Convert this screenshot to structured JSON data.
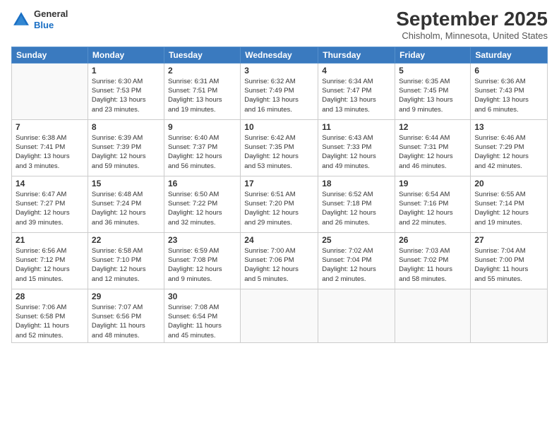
{
  "header": {
    "logo_line1": "General",
    "logo_line2": "Blue",
    "month": "September 2025",
    "location": "Chisholm, Minnesota, United States"
  },
  "weekdays": [
    "Sunday",
    "Monday",
    "Tuesday",
    "Wednesday",
    "Thursday",
    "Friday",
    "Saturday"
  ],
  "weeks": [
    [
      {
        "day": "",
        "info": ""
      },
      {
        "day": "1",
        "info": "Sunrise: 6:30 AM\nSunset: 7:53 PM\nDaylight: 13 hours\nand 23 minutes."
      },
      {
        "day": "2",
        "info": "Sunrise: 6:31 AM\nSunset: 7:51 PM\nDaylight: 13 hours\nand 19 minutes."
      },
      {
        "day": "3",
        "info": "Sunrise: 6:32 AM\nSunset: 7:49 PM\nDaylight: 13 hours\nand 16 minutes."
      },
      {
        "day": "4",
        "info": "Sunrise: 6:34 AM\nSunset: 7:47 PM\nDaylight: 13 hours\nand 13 minutes."
      },
      {
        "day": "5",
        "info": "Sunrise: 6:35 AM\nSunset: 7:45 PM\nDaylight: 13 hours\nand 9 minutes."
      },
      {
        "day": "6",
        "info": "Sunrise: 6:36 AM\nSunset: 7:43 PM\nDaylight: 13 hours\nand 6 minutes."
      }
    ],
    [
      {
        "day": "7",
        "info": "Sunrise: 6:38 AM\nSunset: 7:41 PM\nDaylight: 13 hours\nand 3 minutes."
      },
      {
        "day": "8",
        "info": "Sunrise: 6:39 AM\nSunset: 7:39 PM\nDaylight: 12 hours\nand 59 minutes."
      },
      {
        "day": "9",
        "info": "Sunrise: 6:40 AM\nSunset: 7:37 PM\nDaylight: 12 hours\nand 56 minutes."
      },
      {
        "day": "10",
        "info": "Sunrise: 6:42 AM\nSunset: 7:35 PM\nDaylight: 12 hours\nand 53 minutes."
      },
      {
        "day": "11",
        "info": "Sunrise: 6:43 AM\nSunset: 7:33 PM\nDaylight: 12 hours\nand 49 minutes."
      },
      {
        "day": "12",
        "info": "Sunrise: 6:44 AM\nSunset: 7:31 PM\nDaylight: 12 hours\nand 46 minutes."
      },
      {
        "day": "13",
        "info": "Sunrise: 6:46 AM\nSunset: 7:29 PM\nDaylight: 12 hours\nand 42 minutes."
      }
    ],
    [
      {
        "day": "14",
        "info": "Sunrise: 6:47 AM\nSunset: 7:27 PM\nDaylight: 12 hours\nand 39 minutes."
      },
      {
        "day": "15",
        "info": "Sunrise: 6:48 AM\nSunset: 7:24 PM\nDaylight: 12 hours\nand 36 minutes."
      },
      {
        "day": "16",
        "info": "Sunrise: 6:50 AM\nSunset: 7:22 PM\nDaylight: 12 hours\nand 32 minutes."
      },
      {
        "day": "17",
        "info": "Sunrise: 6:51 AM\nSunset: 7:20 PM\nDaylight: 12 hours\nand 29 minutes."
      },
      {
        "day": "18",
        "info": "Sunrise: 6:52 AM\nSunset: 7:18 PM\nDaylight: 12 hours\nand 26 minutes."
      },
      {
        "day": "19",
        "info": "Sunrise: 6:54 AM\nSunset: 7:16 PM\nDaylight: 12 hours\nand 22 minutes."
      },
      {
        "day": "20",
        "info": "Sunrise: 6:55 AM\nSunset: 7:14 PM\nDaylight: 12 hours\nand 19 minutes."
      }
    ],
    [
      {
        "day": "21",
        "info": "Sunrise: 6:56 AM\nSunset: 7:12 PM\nDaylight: 12 hours\nand 15 minutes."
      },
      {
        "day": "22",
        "info": "Sunrise: 6:58 AM\nSunset: 7:10 PM\nDaylight: 12 hours\nand 12 minutes."
      },
      {
        "day": "23",
        "info": "Sunrise: 6:59 AM\nSunset: 7:08 PM\nDaylight: 12 hours\nand 9 minutes."
      },
      {
        "day": "24",
        "info": "Sunrise: 7:00 AM\nSunset: 7:06 PM\nDaylight: 12 hours\nand 5 minutes."
      },
      {
        "day": "25",
        "info": "Sunrise: 7:02 AM\nSunset: 7:04 PM\nDaylight: 12 hours\nand 2 minutes."
      },
      {
        "day": "26",
        "info": "Sunrise: 7:03 AM\nSunset: 7:02 PM\nDaylight: 11 hours\nand 58 minutes."
      },
      {
        "day": "27",
        "info": "Sunrise: 7:04 AM\nSunset: 7:00 PM\nDaylight: 11 hours\nand 55 minutes."
      }
    ],
    [
      {
        "day": "28",
        "info": "Sunrise: 7:06 AM\nSunset: 6:58 PM\nDaylight: 11 hours\nand 52 minutes."
      },
      {
        "day": "29",
        "info": "Sunrise: 7:07 AM\nSunset: 6:56 PM\nDaylight: 11 hours\nand 48 minutes."
      },
      {
        "day": "30",
        "info": "Sunrise: 7:08 AM\nSunset: 6:54 PM\nDaylight: 11 hours\nand 45 minutes."
      },
      {
        "day": "",
        "info": ""
      },
      {
        "day": "",
        "info": ""
      },
      {
        "day": "",
        "info": ""
      },
      {
        "day": "",
        "info": ""
      }
    ]
  ]
}
